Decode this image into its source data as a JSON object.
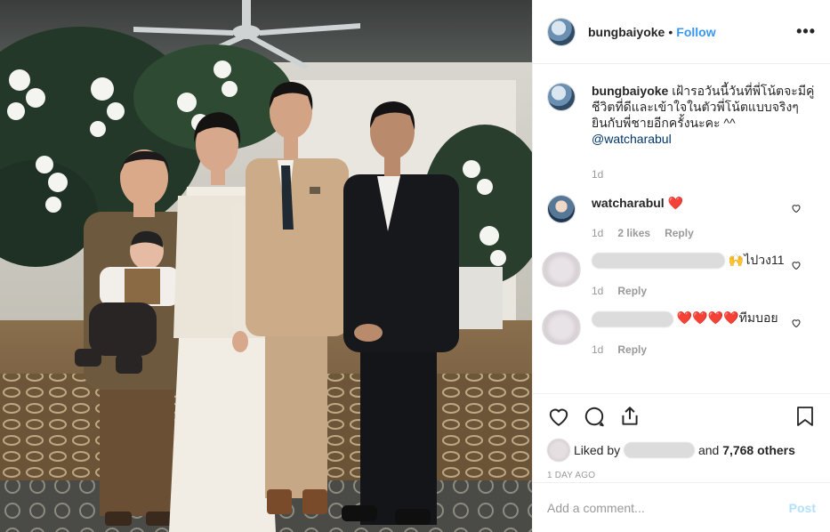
{
  "header": {
    "username": "bungbaiyoke",
    "separator": "•",
    "follow_label": "Follow",
    "more_label": "•••"
  },
  "caption": {
    "username": "bungbaiyoke",
    "text": "เฝ้ารอวันนี้วันที่พี่โน้ตจะมีคู่ชีวิตที่ดีและเข้าใจในตัวพี่โน้ตแบบจริงๆ ยินกับพี่ชายอีกครั้งนะคะ ^^",
    "mention": "@watcharabul",
    "time": "1d"
  },
  "comments": [
    {
      "username": "watcharabul",
      "text": "❤️",
      "time": "1d",
      "likes": "2 likes",
      "reply": "Reply"
    },
    {
      "username": "",
      "text": "🙌ไปวง11",
      "time": "1d",
      "likes": "",
      "reply": "Reply"
    },
    {
      "username": "",
      "text": "❤️❤️❤️❤️ทีมบอย",
      "time": "1d",
      "likes": "",
      "reply": "Reply"
    }
  ],
  "likes": {
    "prefix": "Liked by",
    "and": "and",
    "count": "7,768 others"
  },
  "posted_ago": "1 DAY AGO",
  "add_comment": {
    "placeholder": "Add a comment...",
    "post_label": "Post"
  },
  "colors": {
    "link": "#3897f0",
    "heart": "#ed4956",
    "post_disabled": "#b2dffc"
  }
}
